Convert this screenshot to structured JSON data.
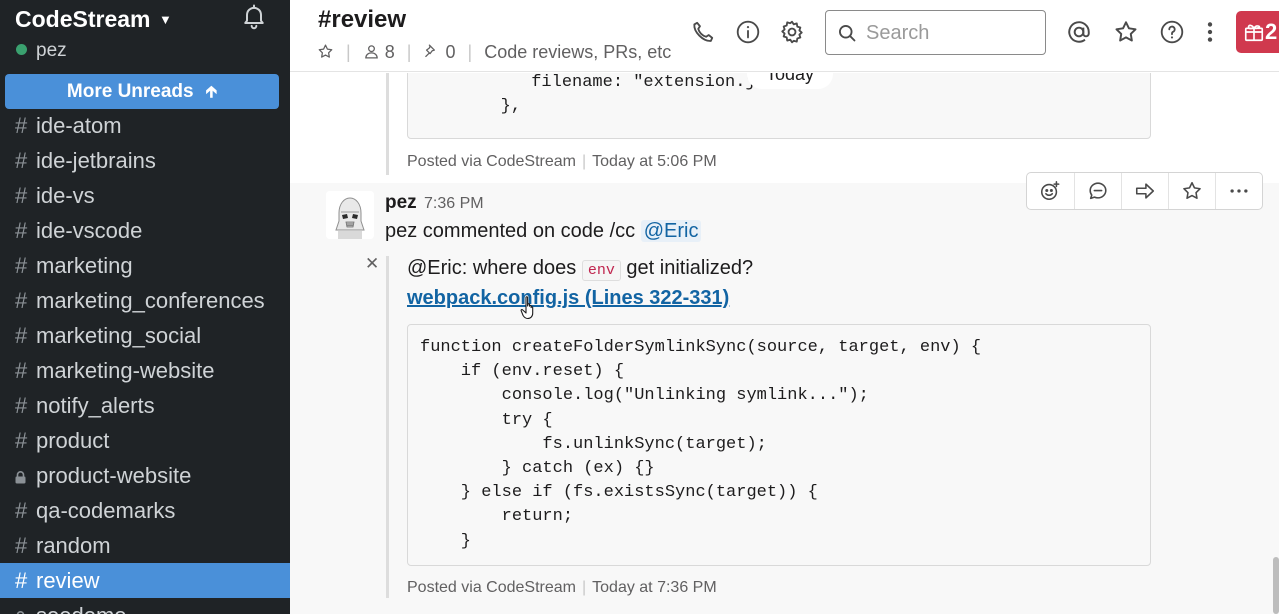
{
  "sidebar": {
    "team_name": "CodeStream",
    "user_name": "pez",
    "more_unreads": "More Unreads",
    "channels": [
      {
        "name": "ide-atom",
        "type": "public"
      },
      {
        "name": "ide-jetbrains",
        "type": "public"
      },
      {
        "name": "ide-vs",
        "type": "public"
      },
      {
        "name": "ide-vscode",
        "type": "public"
      },
      {
        "name": "marketing",
        "type": "public"
      },
      {
        "name": "marketing_conferences",
        "type": "public"
      },
      {
        "name": "marketing_social",
        "type": "public"
      },
      {
        "name": "marketing-website",
        "type": "public"
      },
      {
        "name": "notify_alerts",
        "type": "public"
      },
      {
        "name": "product",
        "type": "public"
      },
      {
        "name": "product-website",
        "type": "private"
      },
      {
        "name": "qa-codemarks",
        "type": "public"
      },
      {
        "name": "random",
        "type": "public"
      },
      {
        "name": "review",
        "type": "public",
        "active": true
      },
      {
        "name": "seedemo",
        "type": "private"
      }
    ]
  },
  "header": {
    "channel_title": "#review",
    "member_count": "8",
    "pinned_count": "0",
    "topic": "Code reviews, PRs, etc",
    "search_placeholder": "Search",
    "gift_label": "2"
  },
  "content": {
    "date_divider": "Today",
    "previous_message": {
      "code_lines": "           filename: \"extension.js\n        },",
      "posted_via": "Posted via CodeStream",
      "posted_time": "Today at 5:06 PM"
    },
    "message": {
      "author": "pez",
      "time": "7:36 PM",
      "text_prefix": "pez commented on code /cc ",
      "mention": "@Eric",
      "comment_before": "@Eric: where does ",
      "comment_code": "env",
      "comment_after": " get initialized?",
      "file_link": "webpack.config.js (Lines 322-331)",
      "code": "function createFolderSymlinkSync(source, target, env) {\n    if (env.reset) {\n        console.log(\"Unlinking symlink...\");\n        try {\n            fs.unlinkSync(target);\n        } catch (ex) {}\n    } else if (fs.existsSync(target)) {\n        return;\n    }",
      "posted_via": "Posted via CodeStream",
      "posted_time": "Today at 7:36 PM"
    }
  },
  "colors": {
    "sidebar_bg": "#1f2326",
    "active_channel": "#4a90d9",
    "presence": "#3aa16f",
    "link": "#1264a3",
    "gift": "#d0394e"
  },
  "icons": {
    "header": [
      "phone-icon",
      "info-icon",
      "gear-icon",
      "search-icon",
      "at-icon",
      "star-icon",
      "help-icon",
      "kebab-icon",
      "gift-icon"
    ],
    "actions": [
      "add-reaction-icon",
      "reply-thread-icon",
      "share-icon",
      "star-icon",
      "more-icon"
    ]
  }
}
